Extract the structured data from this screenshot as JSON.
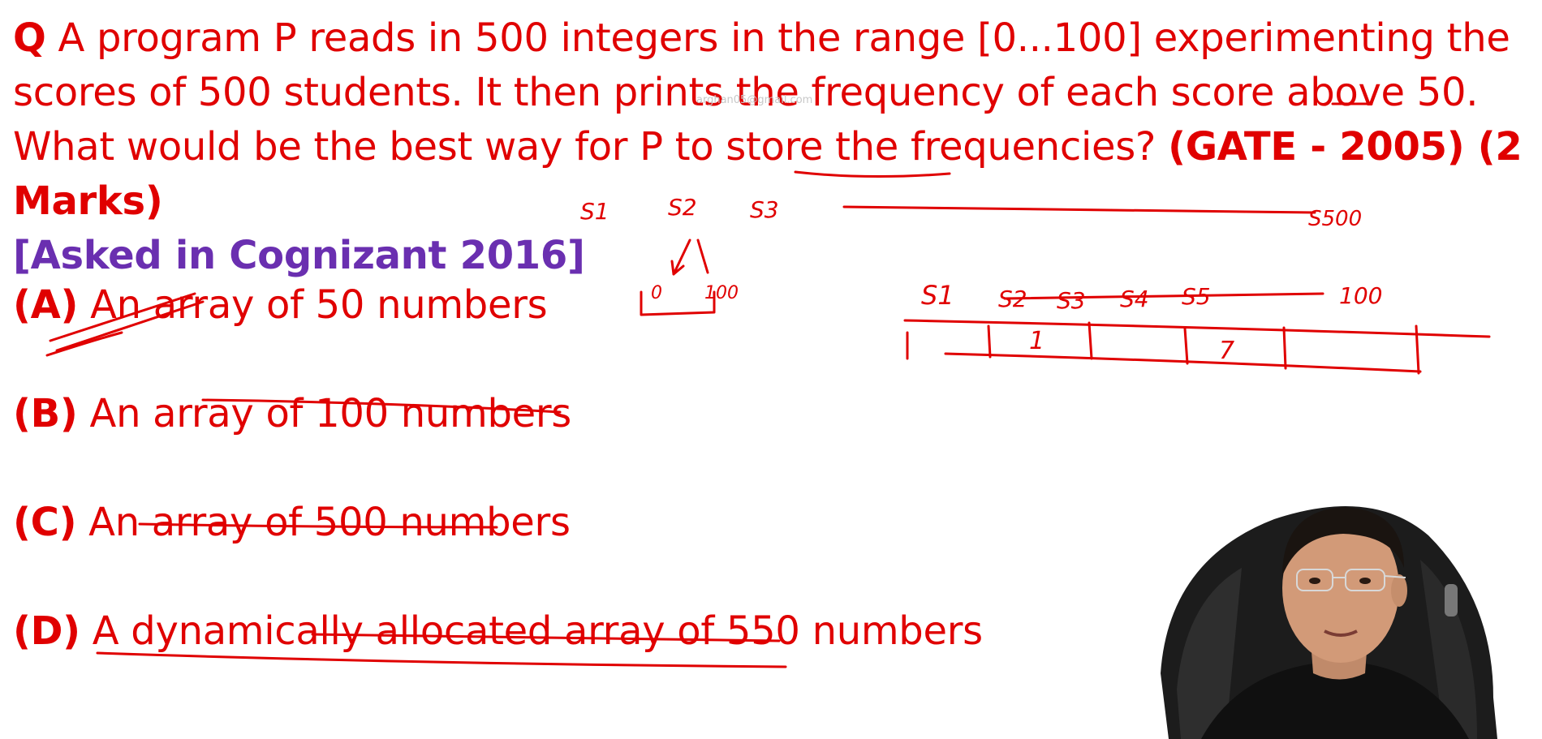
{
  "question": {
    "q_label": "Q",
    "text": "A program P reads in 500 integers in the range [0...100] experimenting the scores of 500 students. It then prints the frequency of each score above 50. What would be the best way for P to store the frequencies?",
    "gate": "(GATE - 2005) (2 Marks)",
    "asked": "[Asked in Cognizant 2016]"
  },
  "options": [
    {
      "letter": "(A)",
      "text": "An array of 50 numbers"
    },
    {
      "letter": "(B)",
      "text": "An array of 100 numbers"
    },
    {
      "letter": "(C)",
      "text": "An array of 500 numbers"
    },
    {
      "letter": "(D)",
      "text": "A dynamically allocated array of 550 numbers"
    }
  ],
  "watermark": "arghan05@gmail.com",
  "colors": {
    "question": "#e00000",
    "asked": "#6a2fb0",
    "ink": "#e00000"
  },
  "annotations": {
    "top_row": [
      "S1",
      "S2",
      "S3",
      "S500"
    ],
    "box_labels": [
      "0",
      "100"
    ],
    "array_labels": [
      "S1",
      "S2",
      "S3",
      "S4",
      "S5",
      "100"
    ],
    "cell_values": [
      "1",
      "7"
    ]
  }
}
